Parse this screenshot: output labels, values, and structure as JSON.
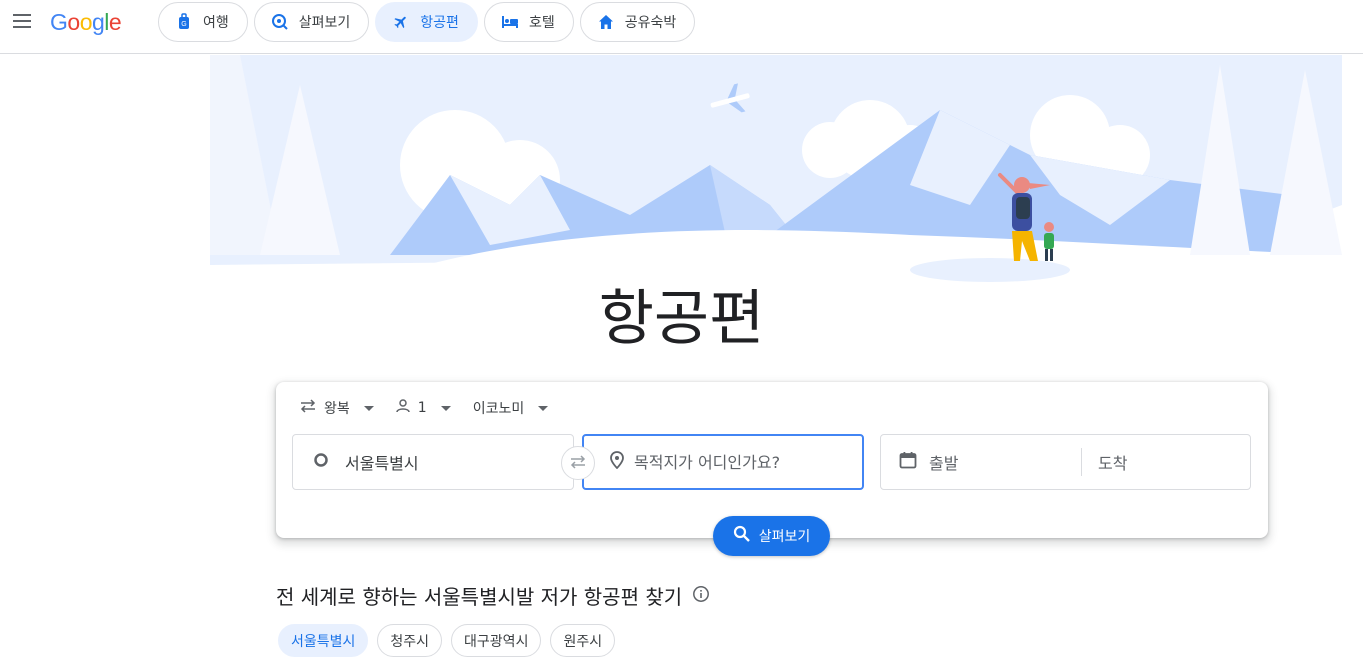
{
  "header": {
    "logo": "Google",
    "nav": [
      {
        "label": "여행",
        "icon": "travel-bag-icon",
        "active": false
      },
      {
        "label": "살펴보기",
        "icon": "explore-icon",
        "active": false
      },
      {
        "label": "항공편",
        "icon": "flight-icon",
        "active": true
      },
      {
        "label": "호텔",
        "icon": "hotel-bed-icon",
        "active": false
      },
      {
        "label": "공유숙박",
        "icon": "home-icon",
        "active": false
      }
    ]
  },
  "main": {
    "title": "항공편"
  },
  "search": {
    "trip_type": "왕복",
    "passengers": "1",
    "cabin_class": "이코노미",
    "origin": "서울특별시",
    "destination_placeholder": "목적지가 어디인가요?",
    "departure_placeholder": "출발",
    "return_placeholder": "도착",
    "search_label": "살펴보기"
  },
  "explore": {
    "heading": "전 세계로 향하는 서울특별시발 저가 항공편 찾기",
    "cities": [
      "서울특별시",
      "청주시",
      "대구광역시",
      "원주시"
    ]
  },
  "colors": {
    "accent": "#1a73e8",
    "accent_light": "#e8f0fe",
    "hero_sky": "#e8f0fe",
    "hero_mountain": "#aecbfa"
  }
}
